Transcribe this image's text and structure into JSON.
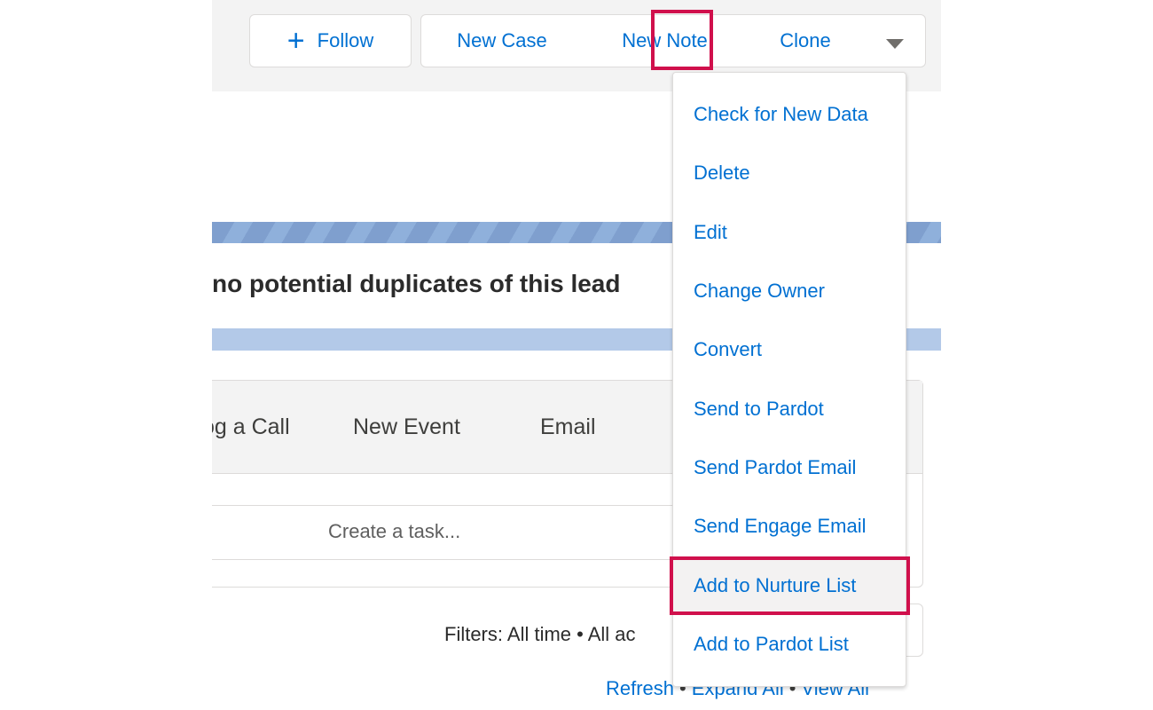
{
  "header": {
    "follow_label": "Follow",
    "new_case_label": "New Case",
    "new_note_label": "New Note",
    "clone_label": "Clone"
  },
  "duplicates": {
    "message": "no potential duplicates of this lead"
  },
  "activity": {
    "tabs": [
      "og a Call",
      "New Event",
      "Email"
    ],
    "task_placeholder": "Create a task...",
    "filters": "Filters: All time • All ac",
    "links": [
      "Refresh",
      "Expand All",
      "View All"
    ]
  },
  "dropdown": {
    "items": [
      "Check for New Data",
      "Delete",
      "Edit",
      "Change Owner",
      "Convert",
      "Send to Pardot",
      "Send Pardot Email",
      "Send Engage Email",
      "Add to Nurture List",
      "Add to Pardot List"
    ],
    "highlighted_item": "Add to Nurture List"
  },
  "colors": {
    "link": "#0070d2",
    "highlight": "#d0104c",
    "header_bg": "#f3f3f3",
    "banner": "#8fb0db"
  },
  "icons": [
    "plus-icon",
    "caret-down-icon"
  ]
}
